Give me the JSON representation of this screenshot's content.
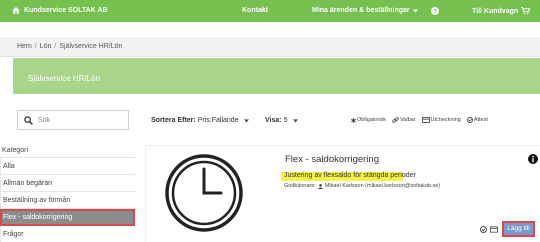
{
  "topbar": {
    "brand": "Kundservice SOLTAK AB",
    "brand_icon": "home-icon",
    "nav": {
      "contact": "Kontakt",
      "my_cases": "Mina ärenden & beställningar",
      "cart": "Till Kundvagn"
    },
    "colors": {
      "bar": "#75c04f",
      "text": "#ffffff"
    }
  },
  "breadcrumb": {
    "items": [
      "Hem",
      "Lön",
      "Självservice HR/Lön"
    ],
    "separator": "/"
  },
  "banner": {
    "title": "Självservice HR/Lön",
    "color": "#a8d58a"
  },
  "search": {
    "placeholder": "Sök"
  },
  "sort": {
    "label": "Sortera Efter:",
    "value": "Pris:Fallande"
  },
  "visa": {
    "label": "Visa:",
    "value": "5"
  },
  "legend": {
    "mandatory": "Obligatorisk",
    "optional": "Valbar",
    "checkout": "Utcheckning",
    "attest": "Attest"
  },
  "sidebar": {
    "header": "Kategori",
    "items": [
      {
        "label": "Alla"
      },
      {
        "label": "Allmän begäran"
      },
      {
        "label": "Beställning av förmån"
      },
      {
        "label": "Flex - saldokorrigering",
        "active": true
      },
      {
        "label": "Frågor"
      }
    ]
  },
  "product": {
    "title": "Flex - saldokorrigering",
    "description": "Justering av flexsaldo för stängda perioder",
    "approver_label": "Godkännare:",
    "approver": "Mikael Karlsson (mikael.karlsson@soltakab.se)",
    "add_label": "Lägg till",
    "icon": "clock-icon"
  }
}
